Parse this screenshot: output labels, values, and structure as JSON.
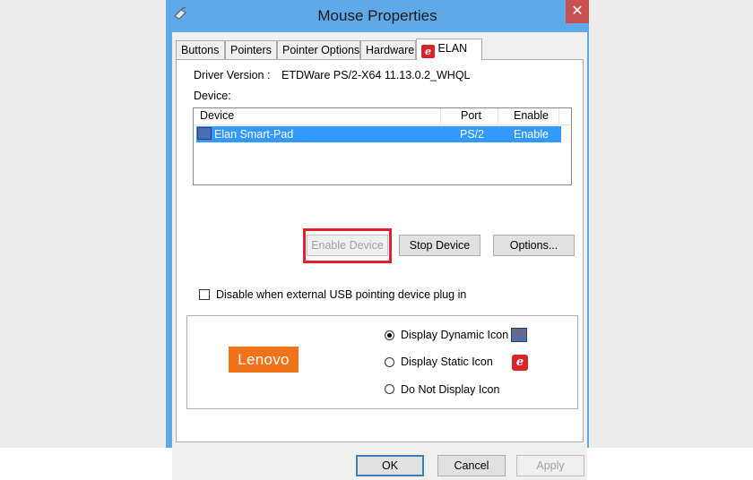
{
  "window": {
    "title": "Mouse Properties",
    "close_glyph": "✕"
  },
  "tabs": [
    {
      "label": "Buttons"
    },
    {
      "label": "Pointers"
    },
    {
      "label": "Pointer Options"
    },
    {
      "label": "Hardware"
    },
    {
      "label": "ELAN",
      "icon": "elan-logo-icon",
      "active": true
    }
  ],
  "elan_tab": {
    "driver_version_label": "Driver Version :",
    "driver_version_value": "ETDWare PS/2-X64 11.13.0.2_WHQL",
    "device_label": "Device:",
    "device_list": {
      "columns": [
        "Device",
        "Port",
        "Enable"
      ],
      "rows": [
        {
          "device": "Elan Smart-Pad",
          "port": "PS/2",
          "enable": "Enable",
          "selected": true
        }
      ]
    },
    "buttons": {
      "enable_device": "Enable Device",
      "stop_device": "Stop Device",
      "options": "Options..."
    },
    "disable_usb_checkbox": {
      "label": "Disable when external USB pointing device plug in",
      "checked": false
    },
    "brand_logo": "Lenovo",
    "icon_display": [
      {
        "label": "Display Dynamic Icon",
        "checked": true,
        "icon": "touchpad-dynamic-icon"
      },
      {
        "label": "Display Static Icon",
        "checked": false,
        "icon": "elan-static-icon"
      },
      {
        "label": "Do Not Display Icon",
        "checked": false
      }
    ]
  },
  "dialog_buttons": {
    "ok": "OK",
    "cancel": "Cancel",
    "apply": "Apply"
  },
  "colors": {
    "title_bar": "#5fa9e8",
    "selection": "#3399ff",
    "highlight_box": "#e3202f",
    "lenovo_logo": "#f0731a"
  }
}
